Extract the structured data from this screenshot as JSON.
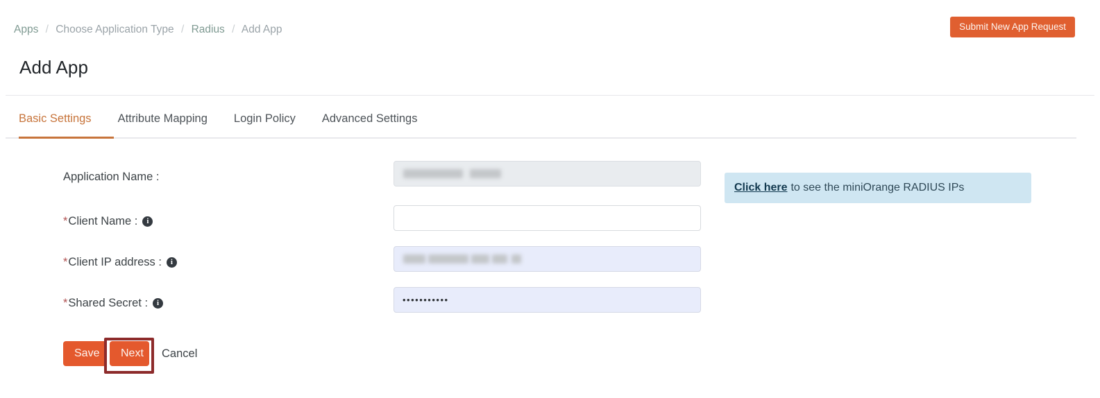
{
  "topbar": {
    "breadcrumb": [
      {
        "label": "Apps",
        "type": "link"
      },
      {
        "label": "Choose Application Type",
        "type": "link"
      },
      {
        "label": "Radius",
        "type": "link"
      },
      {
        "label": "Add App",
        "type": "current"
      }
    ],
    "separator": "/",
    "submit_button_label": "Submit New App Request",
    "submit_button_color": "#e05f30"
  },
  "header": {
    "title": "Add App"
  },
  "tabs": {
    "active_index": 0,
    "accent_color": "#c7743b",
    "items": [
      {
        "label": "Basic Settings"
      },
      {
        "label": "Attribute Mapping"
      },
      {
        "label": "Login Policy"
      },
      {
        "label": "Advanced Settings"
      }
    ]
  },
  "form": {
    "fields": [
      {
        "label": "Application Name :",
        "required": false,
        "has_info_icon": false,
        "value": "",
        "state": "disabled",
        "redacted": true
      },
      {
        "label": "Client Name :",
        "required": true,
        "has_info_icon": true,
        "value": "",
        "state": "empty",
        "redacted": false
      },
      {
        "label": "Client IP address :",
        "required": true,
        "has_info_icon": true,
        "value": "",
        "state": "autofill",
        "redacted": true
      },
      {
        "label": "Shared Secret :",
        "required": true,
        "has_info_icon": true,
        "value": "•••••••••••",
        "state": "autofill",
        "redacted": false
      }
    ],
    "required_marker": "*",
    "info_icon_glyph": "i"
  },
  "side_note": {
    "link_text": "Click here",
    "rest_text": "to see the miniOrange RADIUS IPs",
    "background_color": "#cfe6f2"
  },
  "actions": {
    "save_label": "Save",
    "next_label": "Next",
    "cancel_label": "Cancel",
    "button_color": "#e4592d",
    "highlight_target": "Next",
    "highlight_color": "#8d2b2b"
  }
}
